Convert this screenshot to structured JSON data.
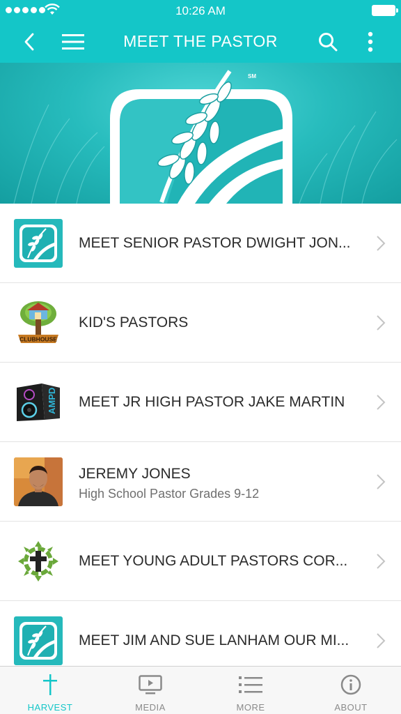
{
  "status_bar": {
    "time": "10:26 AM"
  },
  "nav": {
    "title": "MEET THE PASTOR"
  },
  "banner": {
    "mark": "SM"
  },
  "items": [
    {
      "title": "MEET SENIOR PASTOR DWIGHT JON...",
      "subtitle": "",
      "icon": "wheat-logo-icon"
    },
    {
      "title": "KID'S PASTORS",
      "subtitle": "",
      "icon": "clubhouse-logo-icon",
      "badge_text": "CLUBHOUSE"
    },
    {
      "title": "MEET JR HIGH PASTOR JAKE MARTIN",
      "subtitle": "",
      "icon": "ampd-speaker-icon",
      "badge_text": "AMPD"
    },
    {
      "title": "JEREMY JONES",
      "subtitle": "High School Pastor Grades 9-12",
      "icon": "portrait-photo"
    },
    {
      "title": "MEET YOUNG ADULT PASTORS COR...",
      "subtitle": "",
      "icon": "cross-gear-icon"
    },
    {
      "title": "MEET JIM AND SUE LANHAM OUR MI...",
      "subtitle": "",
      "icon": "wheat-logo-icon"
    }
  ],
  "tabs": [
    {
      "label": "HARVEST",
      "icon": "cross-icon",
      "active": true
    },
    {
      "label": "MEDIA",
      "icon": "tv-play-icon",
      "active": false
    },
    {
      "label": "MORE",
      "icon": "list-icon",
      "active": false
    },
    {
      "label": "ABOUT",
      "icon": "info-icon",
      "active": false
    }
  ],
  "colors": {
    "accent": "#14c6c8",
    "text": "#2b2b2b",
    "subtext": "#6f6f6f"
  }
}
